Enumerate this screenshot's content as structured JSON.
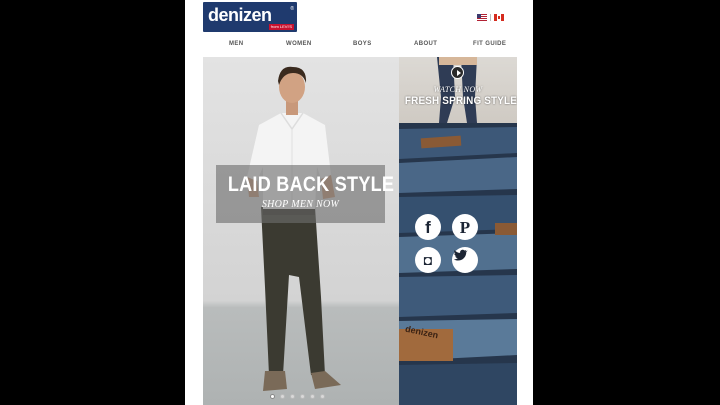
{
  "brand": {
    "name": "denizen",
    "byline": "from LEVI'S"
  },
  "locale": {
    "flags": [
      "us-flag-icon",
      "canada-flag-icon"
    ]
  },
  "nav": [
    "MEN",
    "WOMEN",
    "BOYS",
    "ABOUT",
    "FIT GUIDE"
  ],
  "hero": {
    "title": "LAID BACK STYLE",
    "link": "SHOP MEN NOW",
    "slides": 6,
    "active_slide": 1
  },
  "promo": {
    "subtitle": "WATCH NOW",
    "title": "FRESH SPRING STYLES",
    "icon": "play-icon"
  },
  "denim_tag": "denizen",
  "social": [
    {
      "name": "facebook",
      "glyph": "f"
    },
    {
      "name": "pinterest",
      "glyph": "P"
    },
    {
      "name": "instagram",
      "glyph": "◘"
    },
    {
      "name": "twitter",
      "glyph": "🐦"
    }
  ],
  "colors": {
    "brand_blue": "#1f3a6e",
    "levis_red": "#c8102e",
    "denim": "#2c3e55"
  }
}
